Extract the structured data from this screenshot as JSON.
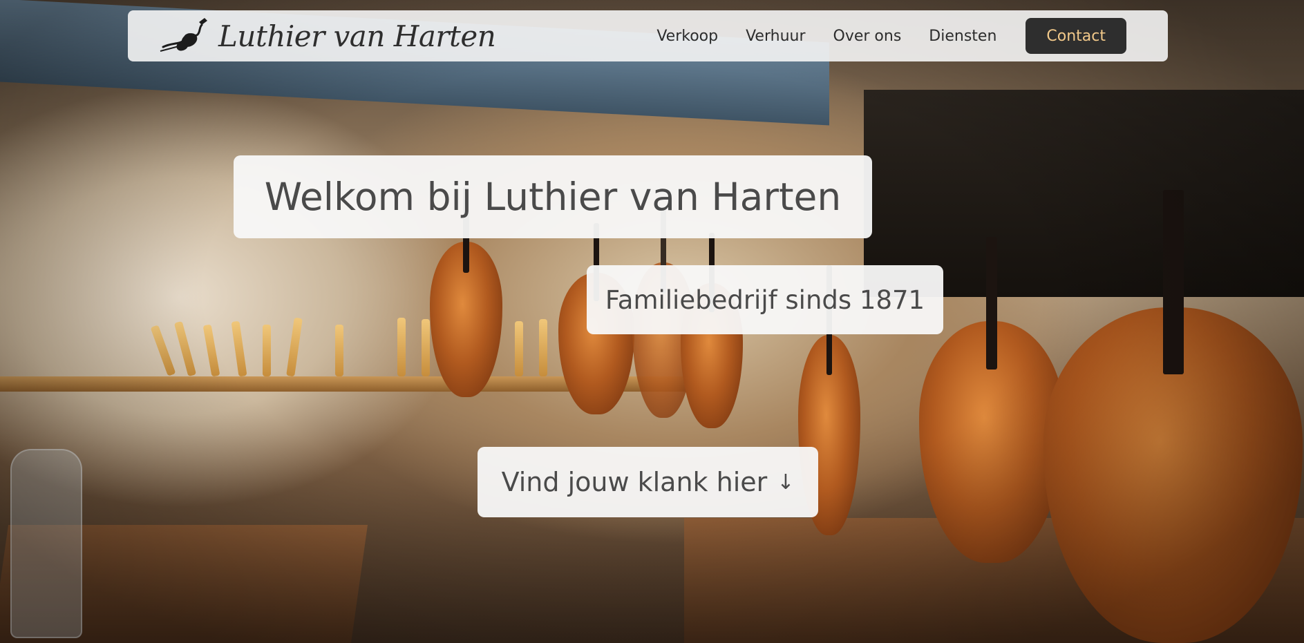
{
  "navbar": {
    "brand_name": "Luthier van Harten",
    "links": [
      "Verkoop",
      "Verhuur",
      "Over ons",
      "Diensten"
    ],
    "contact_label": "Contact"
  },
  "hero": {
    "title": "Welkom bij Luthier van Harten",
    "tagline": "Familiebedrijf sinds 1871",
    "cta_label": "Vind jouw klank hier",
    "cta_arrow": "↓",
    "background_image": "violin-workshop-photo"
  },
  "colors": {
    "nav_background": "#f4f4f4",
    "contact_button_bg": "#2e2e2e",
    "contact_button_text": "#f2c98a",
    "card_background": "#f8f8f8",
    "text": "#4a4a4a"
  },
  "icons": {
    "logo": "violin-icon",
    "cta": "arrow-down-icon"
  }
}
